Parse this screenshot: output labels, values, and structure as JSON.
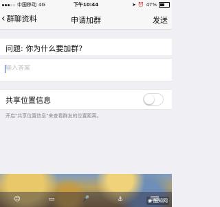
{
  "status": {
    "carrier": "中国移动",
    "network": "4G",
    "time": "下午10:44",
    "battery": "47%"
  },
  "nav": {
    "back_label": "群聊资料",
    "title": "申请加群",
    "send_label": "发送"
  },
  "form": {
    "question": "问题: 你为什么要加群?",
    "answer_value": "",
    "answer_placeholder": "输入答案"
  },
  "location": {
    "label": "共享位置信息",
    "enabled": false,
    "hint": "开启\"共享位置信息\"来查看群友的位置距离。"
  },
  "keyboard": {
    "icons": [
      "emoji-icon",
      "chat-icon",
      "mic-icon",
      "anchor-icon",
      "keyboard-icon"
    ],
    "glyphs": [
      "☺",
      "▭",
      "🎤",
      "⚓",
      "⌨"
    ]
  },
  "watermark": {
    "text": "酷知网"
  },
  "colors": {
    "page_bg": "#f0eff4",
    "bar_bg": "#f7f7f7",
    "caret": "#2d6cdf"
  }
}
